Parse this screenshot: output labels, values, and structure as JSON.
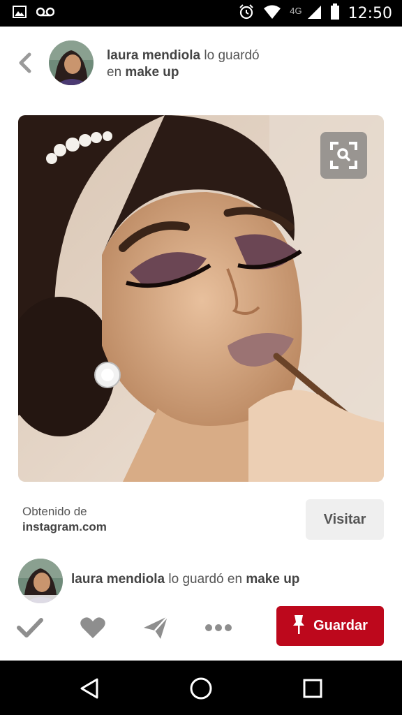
{
  "status_bar": {
    "time": "12:50",
    "network": "4G",
    "icons": [
      "image-icon",
      "voicemail-icon",
      "alarm-icon",
      "wifi-icon",
      "signal-icon",
      "battery-icon"
    ]
  },
  "header": {
    "user_name": "laura mendiola",
    "saved_text": "lo guardó",
    "preposition": "en",
    "board_name": "make up"
  },
  "source": {
    "label": "Obtenido de",
    "domain": "instagram.com",
    "visit_label": "Visitar"
  },
  "board_row": {
    "user_name": "laura mendiola",
    "saved_text": "lo guardó en",
    "board_name": "make up"
  },
  "actions": {
    "save_label": "Guardar",
    "icons": [
      "check-icon",
      "heart-icon",
      "send-icon",
      "more-icon",
      "pin-icon"
    ]
  },
  "colors": {
    "accent": "#bd081c",
    "status_bar": "#000000"
  },
  "nav_bar": {
    "icons": [
      "back-triangle-icon",
      "home-circle-icon",
      "recents-square-icon"
    ]
  }
}
